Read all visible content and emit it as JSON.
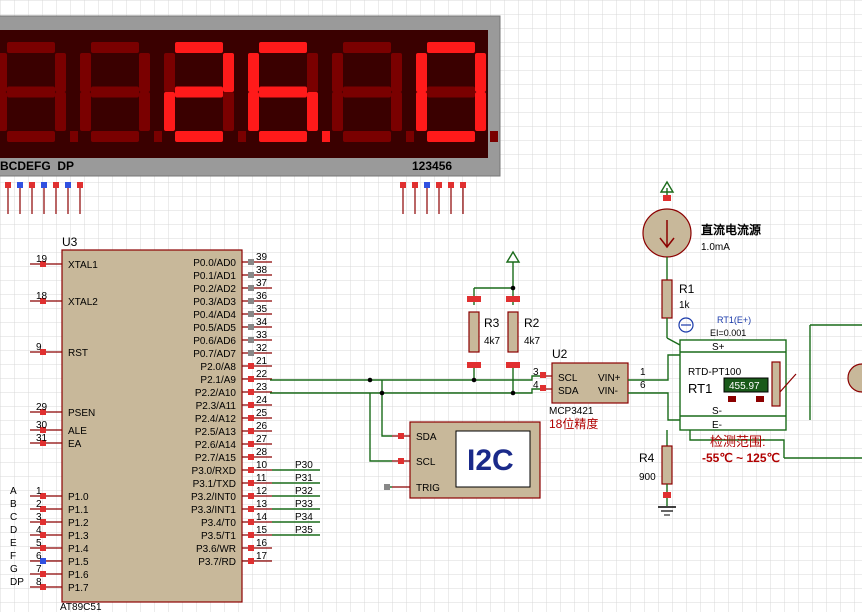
{
  "display": {
    "segment_labels": "BCDEFG  DP",
    "digit_labels": "123456",
    "reading": "26.0",
    "seg_pins": [
      "B",
      "C",
      "D",
      "E",
      "F",
      "G",
      "DP"
    ],
    "digit_pins": [
      "1",
      "2",
      "3",
      "4",
      "5",
      "6"
    ]
  },
  "mcu": {
    "ref": "U3",
    "part": "AT89C51",
    "left_pins": [
      {
        "num": "19",
        "name": "XTAL1"
      },
      {
        "num": "18",
        "name": "XTAL2"
      },
      {
        "num": "9",
        "name": "RST"
      },
      {
        "num": "29",
        "name": "PSEN"
      },
      {
        "num": "30",
        "name": "ALE"
      },
      {
        "num": "31",
        "name": "EA"
      },
      {
        "num": "1",
        "name": "P1.0",
        "net": "A"
      },
      {
        "num": "2",
        "name": "P1.1",
        "net": "B"
      },
      {
        "num": "3",
        "name": "P1.2",
        "net": "C"
      },
      {
        "num": "4",
        "name": "P1.3",
        "net": "D"
      },
      {
        "num": "5",
        "name": "P1.4",
        "net": "E"
      },
      {
        "num": "6",
        "name": "P1.5",
        "net": "F"
      },
      {
        "num": "7",
        "name": "P1.6",
        "net": "G"
      },
      {
        "num": "8",
        "name": "P1.7",
        "net": "DP"
      }
    ],
    "right_pins": [
      {
        "num": "39",
        "name": "P0.0/AD0"
      },
      {
        "num": "38",
        "name": "P0.1/AD1"
      },
      {
        "num": "37",
        "name": "P0.2/AD2"
      },
      {
        "num": "36",
        "name": "P0.3/AD3"
      },
      {
        "num": "35",
        "name": "P0.4/AD4"
      },
      {
        "num": "34",
        "name": "P0.5/AD5"
      },
      {
        "num": "33",
        "name": "P0.6/AD6"
      },
      {
        "num": "32",
        "name": "P0.7/AD7"
      },
      {
        "num": "21",
        "name": "P2.0/A8"
      },
      {
        "num": "22",
        "name": "P2.1/A9"
      },
      {
        "num": "23",
        "name": "P2.2/A10"
      },
      {
        "num": "24",
        "name": "P2.3/A11"
      },
      {
        "num": "25",
        "name": "P2.4/A12"
      },
      {
        "num": "26",
        "name": "P2.5/A13"
      },
      {
        "num": "27",
        "name": "P2.6/A14"
      },
      {
        "num": "28",
        "name": "P2.7/A15"
      },
      {
        "num": "10",
        "name": "P3.0/RXD",
        "net": "P30"
      },
      {
        "num": "11",
        "name": "P3.1/TXD",
        "net": "P31"
      },
      {
        "num": "12",
        "name": "P3.2/INT0",
        "net": "P32"
      },
      {
        "num": "13",
        "name": "P3.3/INT1",
        "net": "P33"
      },
      {
        "num": "14",
        "name": "P3.4/T0",
        "net": "P34"
      },
      {
        "num": "15",
        "name": "P3.5/T1",
        "net": "P35"
      },
      {
        "num": "16",
        "name": "P3.6/WR"
      },
      {
        "num": "17",
        "name": "P3.7/RD"
      }
    ]
  },
  "r3": {
    "ref": "R3",
    "value": "4k7"
  },
  "r2": {
    "ref": "R2",
    "value": "4k7"
  },
  "adc": {
    "ref": "U2",
    "part": "MCP3421",
    "note": "18位精度",
    "pins": [
      {
        "num": "3",
        "name": "SCL"
      },
      {
        "num": "4",
        "name": "SDA"
      },
      {
        "num": "1",
        "name": "VIN+"
      },
      {
        "num": "6",
        "name": "VIN-"
      }
    ]
  },
  "i2c": {
    "label": "I2C",
    "pins": [
      "SDA",
      "SCL",
      "TRIG"
    ]
  },
  "source": {
    "name": "直流电流源",
    "value": "1.0mA"
  },
  "r1": {
    "ref": "R1",
    "value": "1k",
    "probe": "RT1(E+)",
    "probe_value": "EI=0.001"
  },
  "rt1": {
    "ref": "RT1",
    "part": "RTD-PT100",
    "reading": "455.97",
    "pins": [
      "S+",
      "S-",
      "E-"
    ]
  },
  "range": {
    "title": "检测范围:",
    "value": "-55℃ ~ 125℃"
  },
  "r4": {
    "ref": "R4",
    "value": "900"
  }
}
